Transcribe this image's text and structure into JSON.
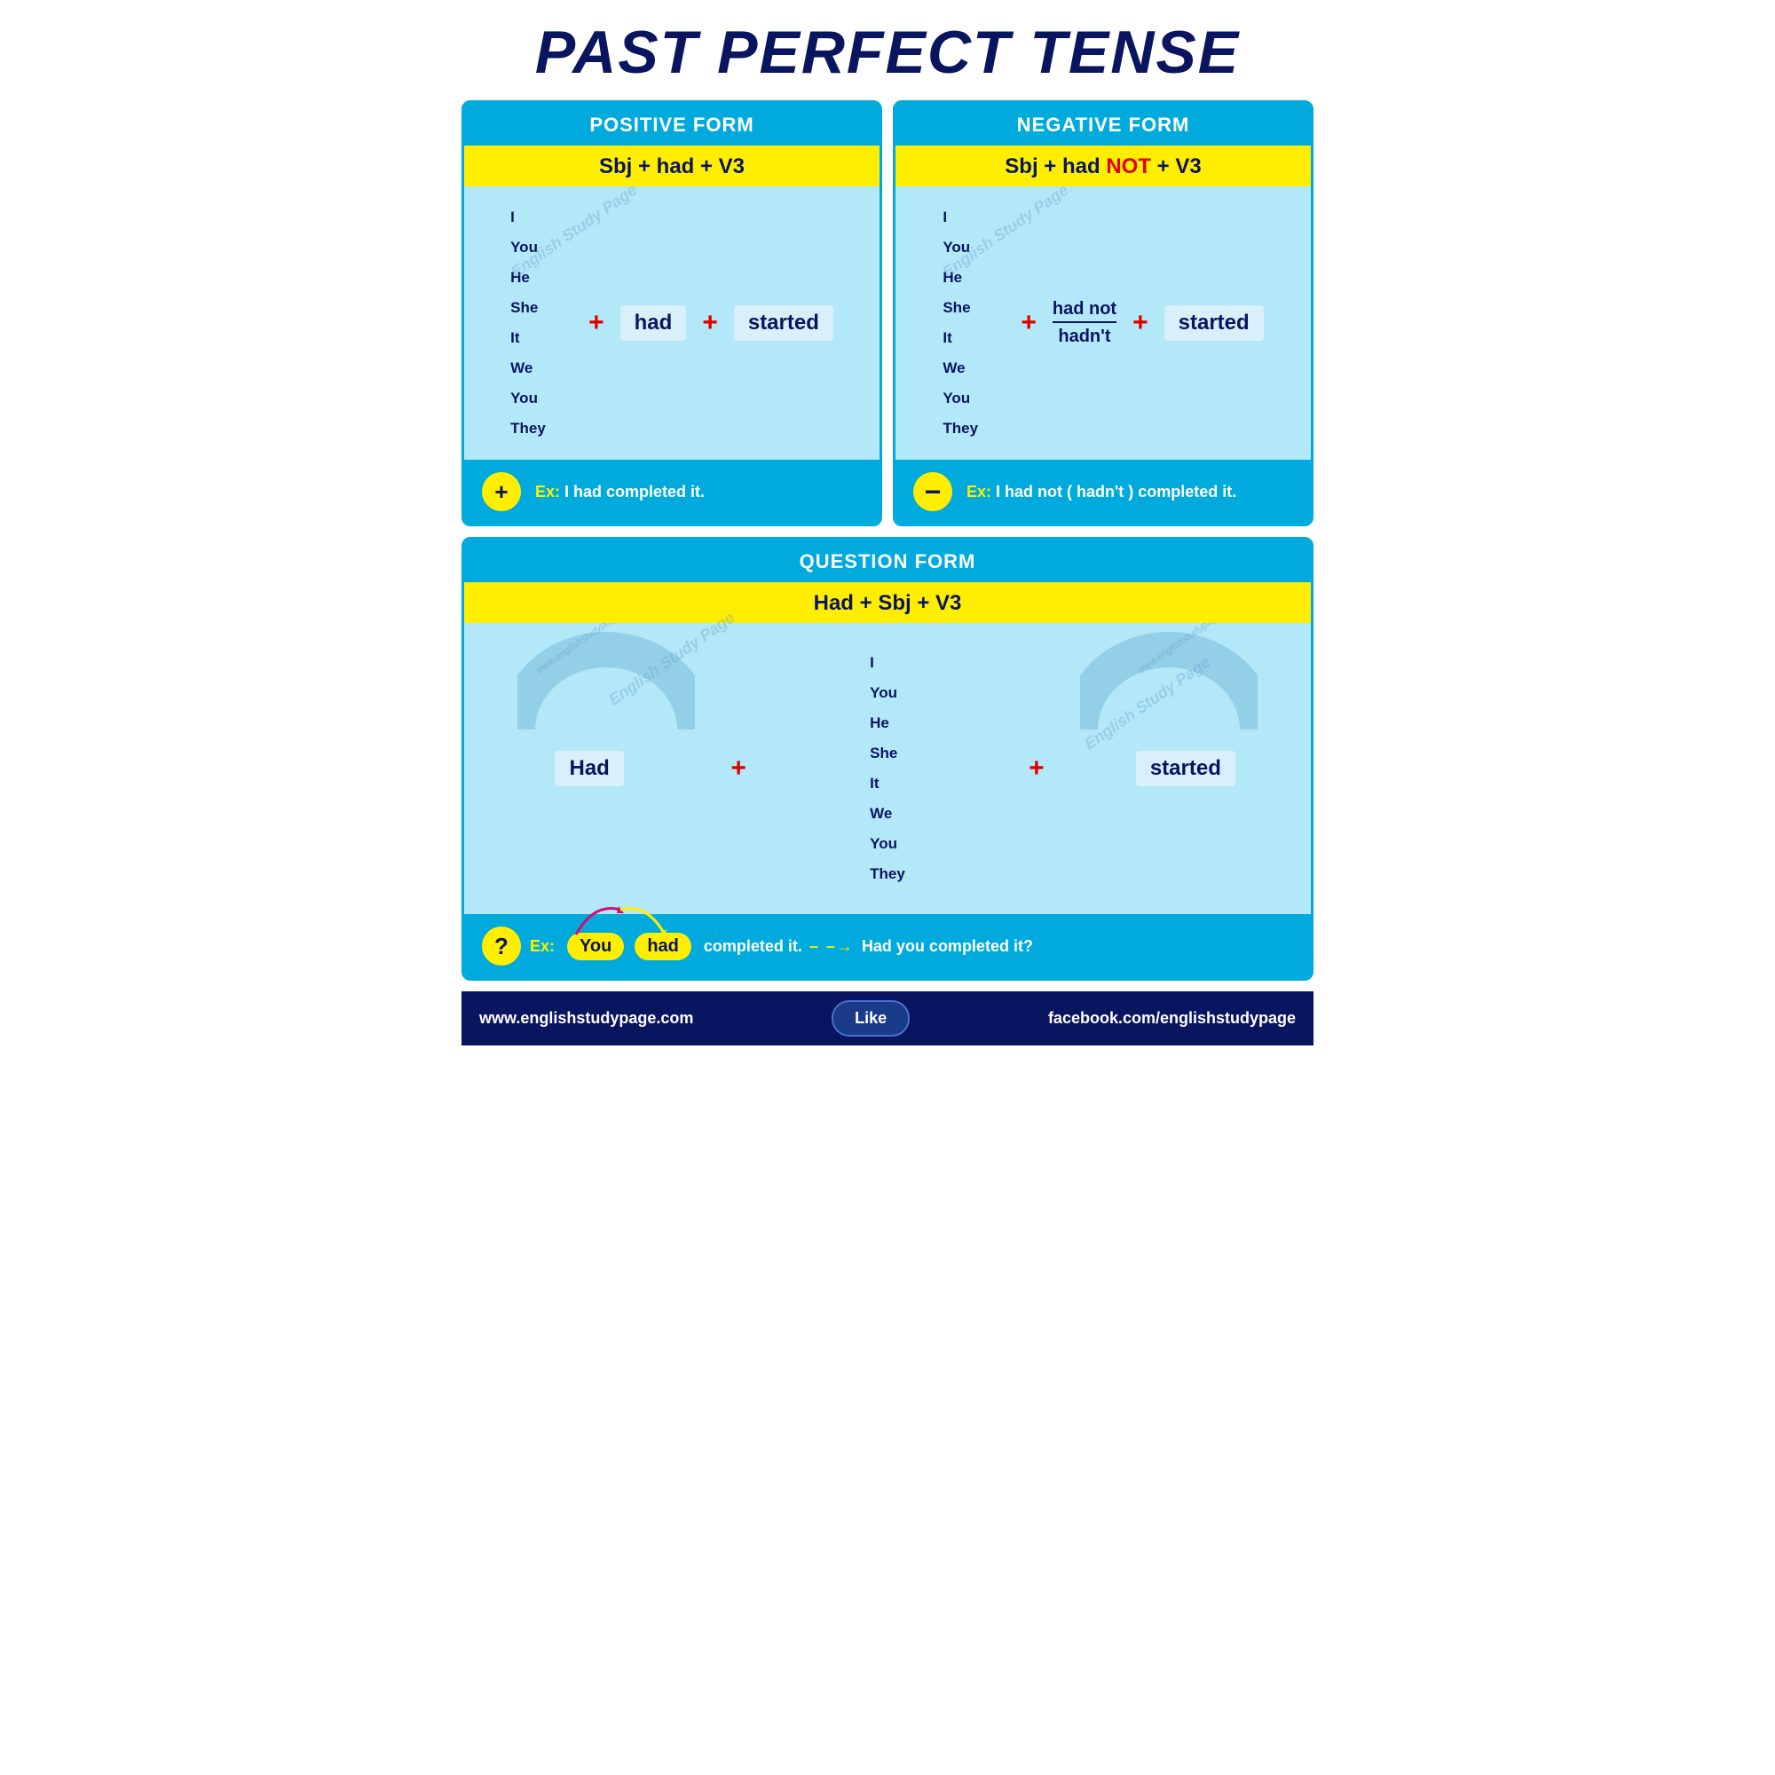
{
  "title": "PAST PERFECT TENSE",
  "positive": {
    "header": "POSITIVE FORM",
    "formula": "Sbj + had + V3",
    "pronouns": [
      "I",
      "You",
      "He",
      "She",
      "It",
      "We",
      "You",
      "They"
    ],
    "had": "had",
    "started": "started",
    "example_label": "Ex:",
    "example_text": "I had completed it.",
    "circle_symbol": "+"
  },
  "negative": {
    "header": "NEGATIVE FORM",
    "formula_before": "Sbj + had ",
    "formula_not": "NOT",
    "formula_after": " + V3",
    "pronouns": [
      "I",
      "You",
      "He",
      "She",
      "It",
      "We",
      "You",
      "They"
    ],
    "had_not": "had not",
    "hadnt": "hadn't",
    "started": "started",
    "example_label": "Ex:",
    "example_text": "I had not ( hadn't ) completed it.",
    "circle_symbol": "−"
  },
  "question": {
    "header": "QUESTION FORM",
    "formula": "Had +  Sbj + V3",
    "had": "Had",
    "pronouns": [
      "I",
      "You",
      "He",
      "She",
      "It",
      "We",
      "You",
      "They"
    ],
    "started": "started",
    "example_label": "Ex:",
    "example_you": "You",
    "example_had": "had",
    "example_completed": "completed it.",
    "example_arrow": "– –→",
    "example_result": "Had you completed it?",
    "circle_symbol": "?"
  },
  "footer": {
    "left": "www.englishstudypage.com",
    "like": "Like",
    "right": "facebook.com/englishstudypage"
  },
  "watermarks": [
    "English Study Page",
    "English Study Page",
    "English Study Page",
    "English Study Page"
  ]
}
